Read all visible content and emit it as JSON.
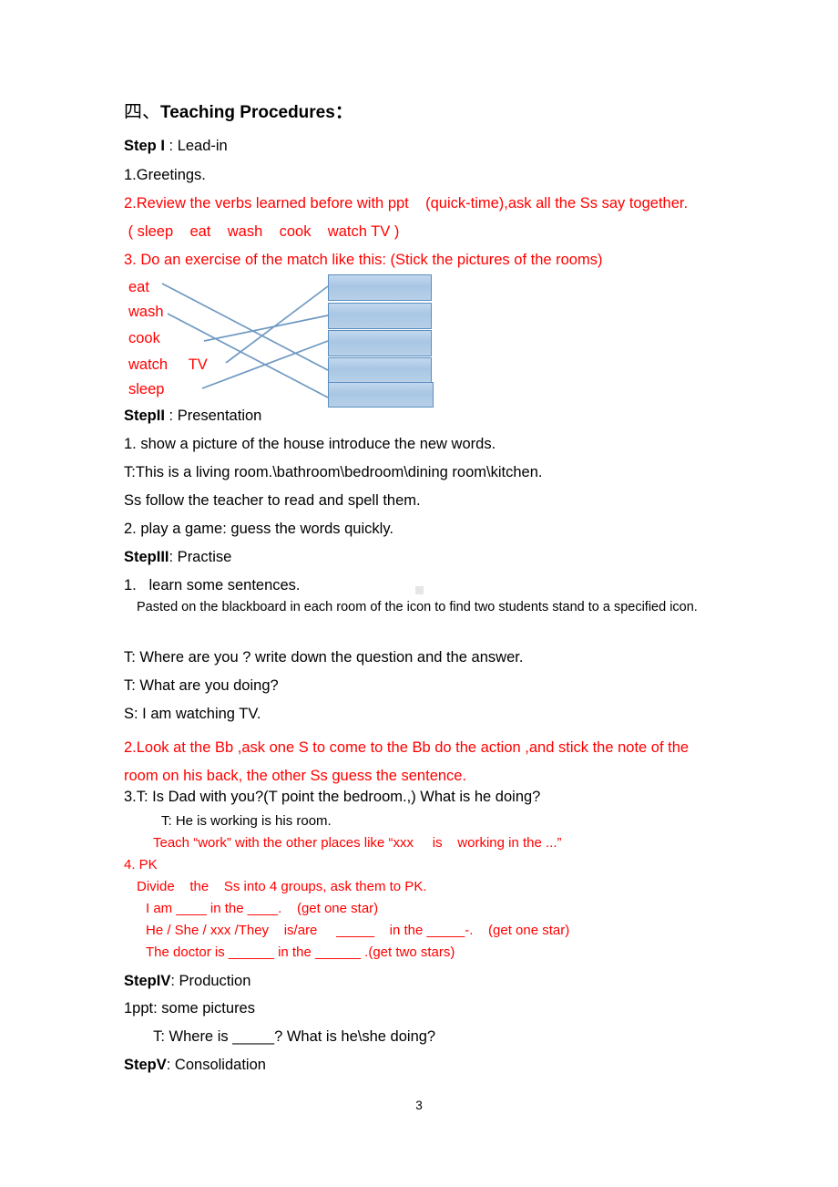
{
  "document": {
    "page_number": "3",
    "accent_red": "#ff0000",
    "box_fill": "#b3cee8",
    "box_border": "#5b8fc0",
    "line_color": "#6f99c2"
  },
  "heading": {
    "cjk": "四",
    "punct": "、",
    "title": "Teaching Procedures",
    "colon": "："
  },
  "step1": {
    "label": "Step I",
    "title": " : Lead-in",
    "items": [
      "1.Greetings.",
      "2.Review the verbs learned before with ppt    (quick-time),ask all the Ss say together.",
      " ( sleep    eat    wash    cook    watch TV )",
      "3. Do an exercise of the match like this: (Stick the pictures of the rooms)"
    ]
  },
  "match_exercise": {
    "words": [
      "eat",
      "wash",
      "cook",
      "watch     TV",
      "sleep"
    ],
    "boxes": [
      "",
      "",
      "",
      "",
      ""
    ],
    "links": [
      {
        "from": "eat",
        "to": "box4"
      },
      {
        "from": "wash",
        "to": "box5"
      },
      {
        "from": "cook",
        "to": "box2"
      },
      {
        "from": "watch TV",
        "to": "box1"
      },
      {
        "from": "sleep",
        "to": "box3"
      }
    ]
  },
  "step2": {
    "label": "StepII",
    "title": " : Presentation",
    "items": [
      "1. show a picture of the house introduce the new words.",
      "T:This is a living room.\\bathroom\\bedroom\\dining room\\kitchen.",
      "Ss follow the teacher to read and spell them.",
      "2. play a game: guess the words quickly."
    ]
  },
  "step3": {
    "label": "StepIII",
    "title": ": Practise",
    "item1": "1.   learn some sentences.",
    "item1_note": "Pasted on the blackboard in each room of the icon to find two students stand to a specified icon.",
    "dialogue": [
      "T: Where are you ? write down the question and the answer.",
      "T: What are you doing?",
      "S: I am watching TV."
    ],
    "red_item2": "2.Look at the Bb ,ask one S to come to the Bb do the action ,and stick the note of the room on his back, the other Ss guess the sentence.",
    "item3_num": "3.",
    "item3": "T: Is Dad with you?(T point the bedroom.,) What is he doing?",
    "item3_sub": "T: He is working is his room.",
    "item3_red": "Teach “work” with the other places like “xxx     is    working in the ...”",
    "item4": "4. PK",
    "item4_sub": "Divide    the    Ss into 4 groups, ask them to PK.",
    "pk_lines": [
      "I am ____ in the ____.    (get one star)",
      "He / She / xxx /They    is/are     _____    in the _____-.    (get one star)",
      "The doctor is ______ in the ______ .(get two stars)"
    ]
  },
  "step4": {
    "label": "StepIV",
    "title": ": Production",
    "items": [
      "1ppt: some pictures",
      "       T: Where is _____? What is he\\she doing?"
    ]
  },
  "step5": {
    "label": "StepV",
    "title": ": Consolidation"
  }
}
